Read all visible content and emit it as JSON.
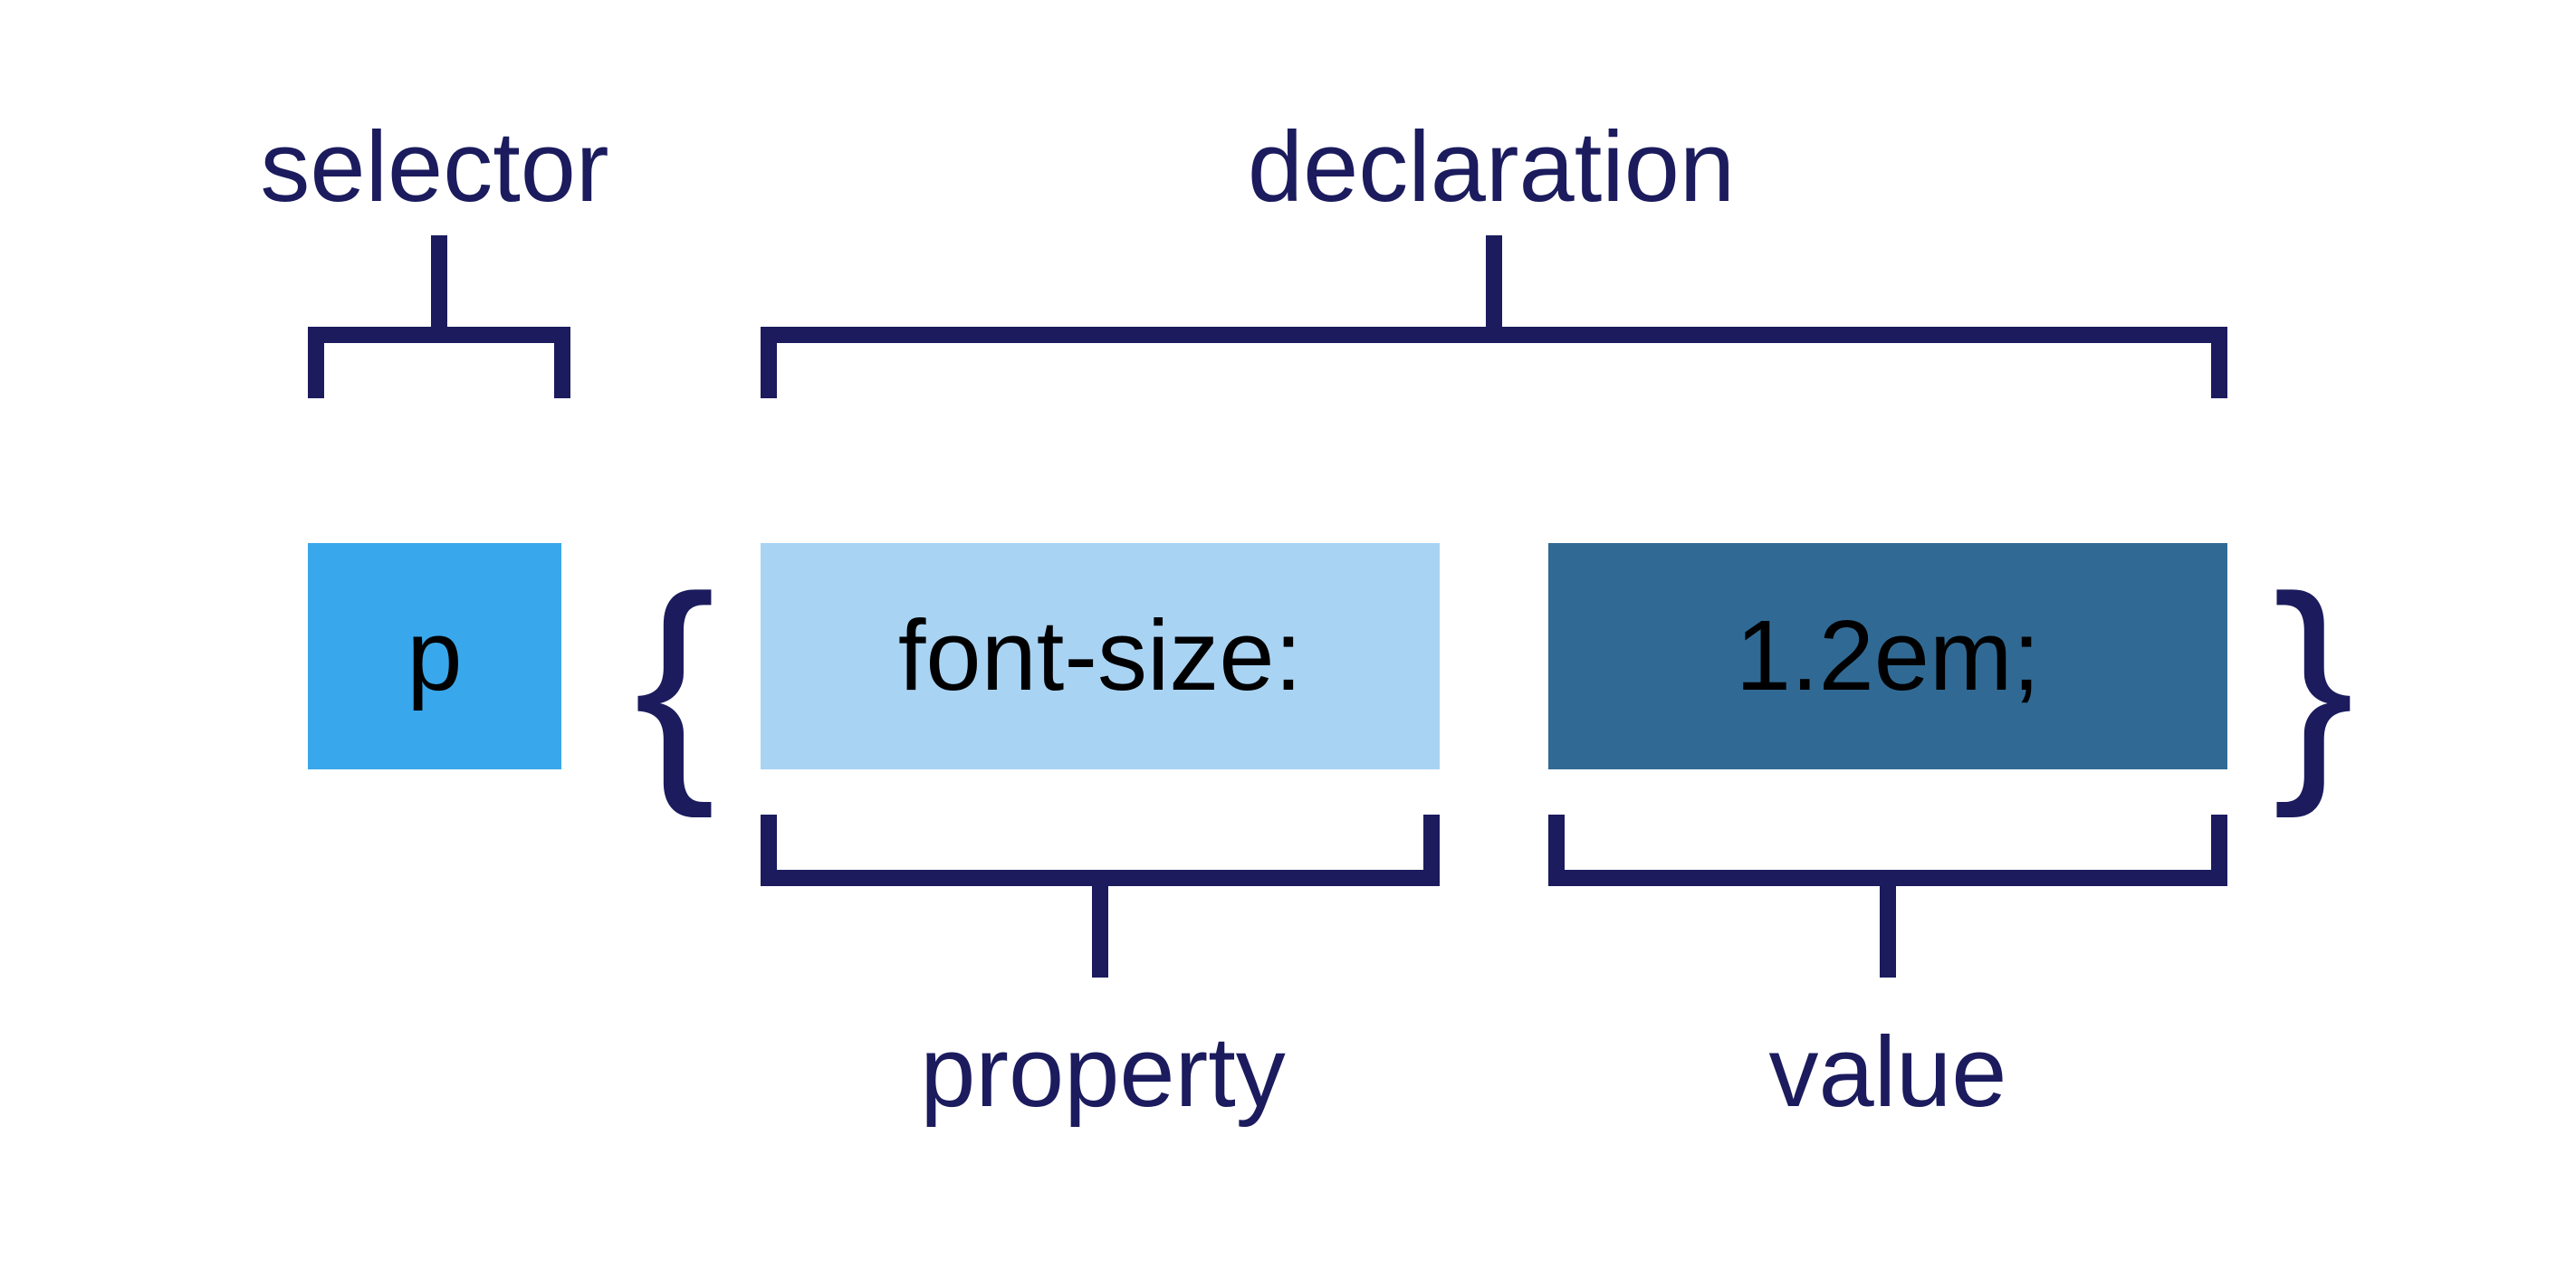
{
  "labels": {
    "selector": "selector",
    "declaration": "declaration",
    "property": "property",
    "value": "value"
  },
  "code": {
    "selector": "p",
    "brace_open": "{",
    "property": "font-size:",
    "value": "1.2em;",
    "brace_close": "}"
  },
  "colors": {
    "label": "#1b1b5e",
    "brace": "#1b1b5e",
    "bracket": "#1b1b5e",
    "selector_bg": "#39a7eb",
    "property_bg": "#a9d3f3",
    "value_bg": "#306a94",
    "text": "#000000"
  }
}
